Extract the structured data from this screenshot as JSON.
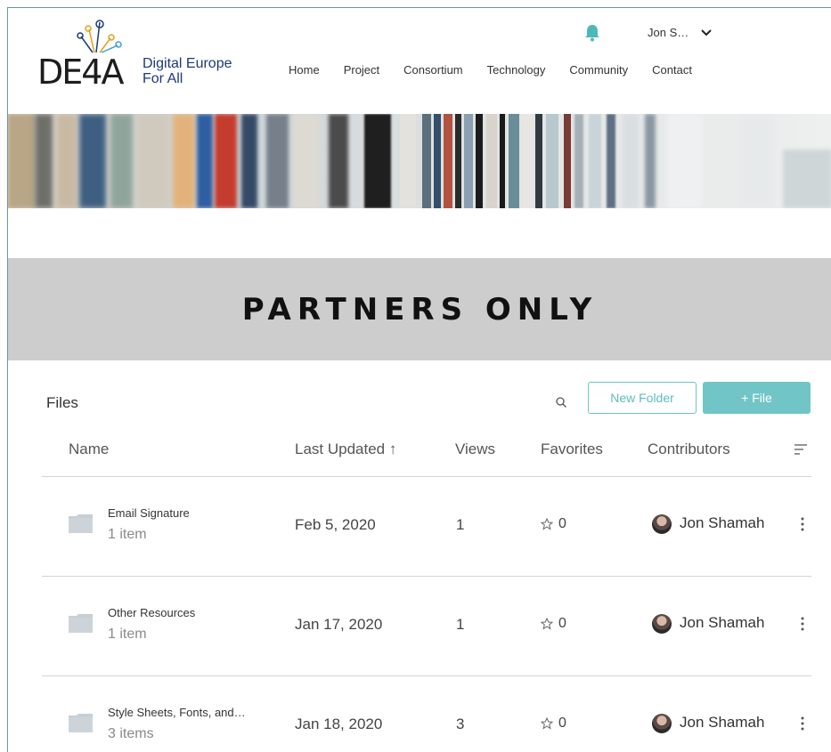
{
  "header": {
    "logo_mark": "DE4A",
    "logo_line1": "Digital Europe",
    "logo_line2": "For All",
    "nav": [
      "Home",
      "Project",
      "Consortium",
      "Technology",
      "Community",
      "Contact"
    ],
    "user_name": "Jon S…"
  },
  "banner": {
    "title": "PARTNERS ONLY"
  },
  "files": {
    "label": "Files",
    "new_folder_label": "New Folder",
    "add_file_label": "+ File"
  },
  "table": {
    "columns": {
      "name": "Name",
      "last_updated": "Last Updated ↑",
      "views": "Views",
      "favorites": "Favorites",
      "contributors": "Contributors"
    },
    "rows": [
      {
        "name": "Email Signature",
        "count": "1 item",
        "date": "Feb 5, 2020",
        "views": "1",
        "favorites": "0",
        "contributor": "Jon Shamah"
      },
      {
        "name": "Other Resources",
        "count": "1 item",
        "date": "Jan 17, 2020",
        "views": "1",
        "favorites": "0",
        "contributor": "Jon Shamah"
      },
      {
        "name": "Style Sheets, Fonts, and…",
        "count": "3 items",
        "date": "Jan 18, 2020",
        "views": "3",
        "favorites": "0",
        "contributor": "Jon Shamah"
      }
    ]
  },
  "colors": {
    "accent": "#72c5c6",
    "banner_bg": "#cdcdcd",
    "logo_blue": "#1b3a7a",
    "bell": "#4cb8ba"
  }
}
